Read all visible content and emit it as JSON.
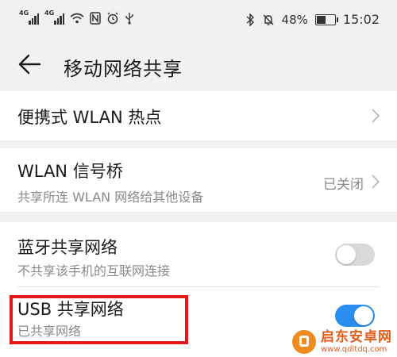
{
  "status_bar": {
    "net1": "4G",
    "net2": "4G",
    "battery_percent": "48%",
    "battery_level": 0.48,
    "time": "15:02",
    "icons": [
      "signal-icon",
      "signal-icon",
      "wifi-icon",
      "nfc-icon",
      "alarm-icon",
      "usb-icon",
      "bluetooth-icon",
      "mute-icon",
      "battery-icon"
    ]
  },
  "header": {
    "title": "移动网络共享"
  },
  "items": {
    "hotspot": {
      "title": "便携式 WLAN 热点"
    },
    "bridge": {
      "title": "WLAN 信号桥",
      "subtitle": "共享所连 WLAN 网络给其他设备",
      "status": "已关闭"
    },
    "bluetooth": {
      "title": "蓝牙共享网络",
      "subtitle": "不共享该手机的互联网连接",
      "toggle_on": false
    },
    "usb": {
      "title": "USB 共享网络",
      "subtitle": "已共享网络",
      "toggle_on": true
    }
  },
  "watermark": {
    "name": "启东安卓网",
    "url": "www.qdltdq.com"
  },
  "colors": {
    "accent": "#2a8ef0",
    "highlight": "#e31818",
    "background": "#f1f1f1"
  }
}
